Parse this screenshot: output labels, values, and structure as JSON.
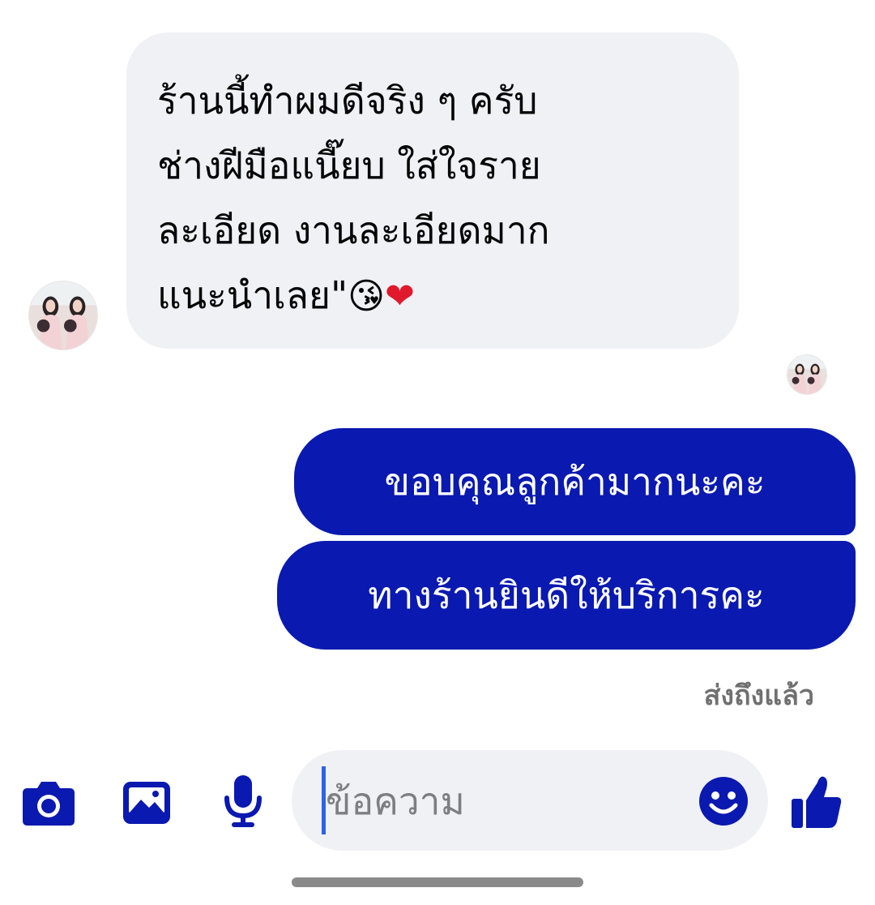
{
  "conversation": {
    "incoming": {
      "lines": [
        "ร้านนี้ทำผมดีจริง ๆ ครับ",
        "ช่างฝีมือแนี๊ยบ ใส่ใจราย",
        "ละเอียด งานละเอียดมาก",
        "แนะนำเลย\""
      ],
      "emojis": [
        "😘",
        "❤"
      ]
    },
    "outgoing": [
      {
        "text": "ขอบคุณลูกค้ามากนะคะ"
      },
      {
        "text": "ทางร้านยินดีให้บริการคะ"
      }
    ],
    "status": "ส่งถึงแล้ว"
  },
  "composer": {
    "placeholder": "ข้อความ",
    "icons": [
      "camera-icon",
      "image-icon",
      "microphone-icon",
      "smiley-icon",
      "thumbs-up-icon"
    ],
    "accent_color": "#0a19b0",
    "input_background": "#f0f1f5"
  },
  "colors": {
    "incoming_bubble": "#f0f1f5",
    "outgoing_bubble": "#0a19b0",
    "status_text": "#707070"
  }
}
